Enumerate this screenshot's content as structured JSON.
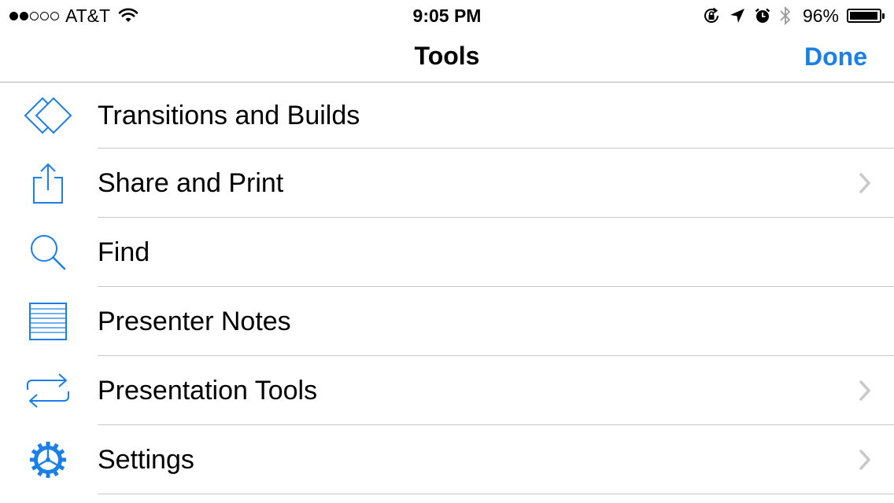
{
  "status_bar": {
    "carrier": "AT&T",
    "signal_bars_filled": 2,
    "signal_bars_total": 5,
    "time": "9:05 PM",
    "battery_percent": "96%",
    "battery_level": 0.96,
    "icons": [
      "wifi-icon",
      "rotation-lock-icon",
      "location-arrow-icon",
      "alarm-icon",
      "bluetooth-icon",
      "battery-icon"
    ]
  },
  "navbar": {
    "title": "Tools",
    "done_label": "Done"
  },
  "colors": {
    "accent": "#1a7fe6",
    "separator": "#c8c7cc",
    "chevron": "#c7c7cc"
  },
  "tools": [
    {
      "label": "Transitions and Builds",
      "icon": "transitions-icon",
      "has_chevron": false
    },
    {
      "label": "Share and Print",
      "icon": "share-icon",
      "has_chevron": true
    },
    {
      "label": "Find",
      "icon": "search-icon",
      "has_chevron": false
    },
    {
      "label": "Presenter Notes",
      "icon": "notes-icon",
      "has_chevron": false
    },
    {
      "label": "Presentation Tools",
      "icon": "presentation-tools-icon",
      "has_chevron": true
    },
    {
      "label": "Settings",
      "icon": "settings-gear-icon",
      "has_chevron": true
    }
  ]
}
